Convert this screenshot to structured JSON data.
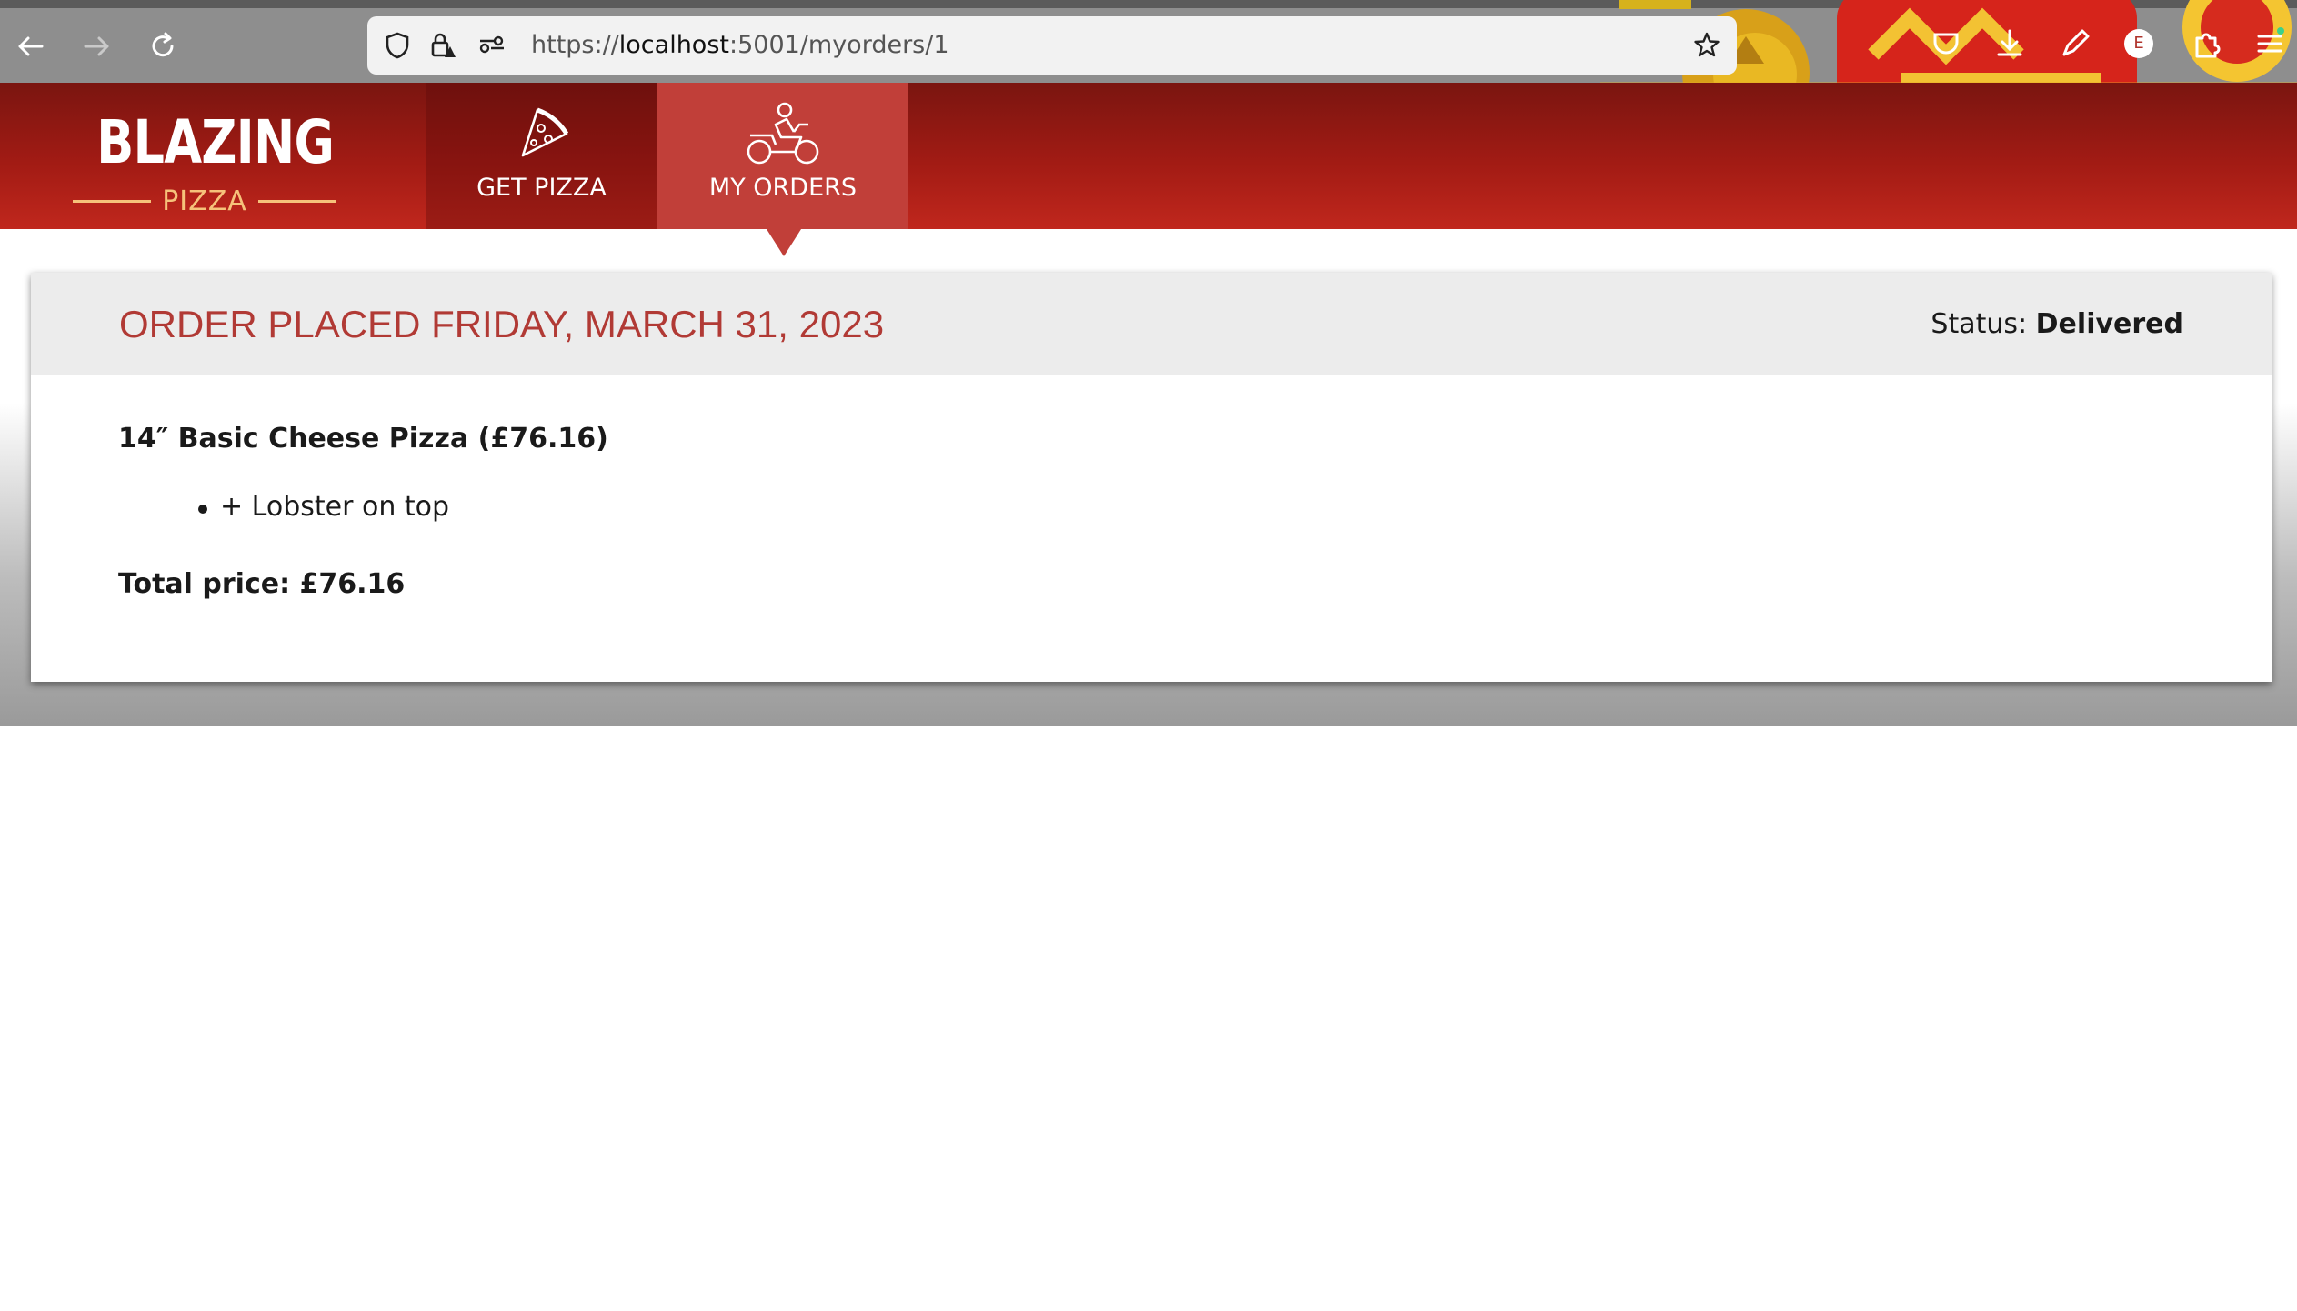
{
  "browser": {
    "url_scheme": "https://",
    "url_host": "localhost",
    "url_path": ":5001/myorders/1",
    "profile_initial": "E"
  },
  "site": {
    "logo_title": "BLAZING",
    "logo_subtitle": "PIZZA",
    "nav": {
      "get_pizza": "GET PIZZA",
      "my_orders": "MY ORDERS"
    }
  },
  "order": {
    "title": "ORDER PLACED FRIDAY, MARCH 31, 2023",
    "status_label": "Status:",
    "status_value": "Delivered",
    "item": "14″ Basic Cheese Pizza (£76.16)",
    "toppings": [
      "+ Lobster on top"
    ],
    "total": "Total price: £76.16"
  },
  "colors": {
    "header_red": "#a21b14",
    "active_tab": "#c13f39",
    "title_red": "#b13a35",
    "logo_gold": "#f6c27a"
  }
}
